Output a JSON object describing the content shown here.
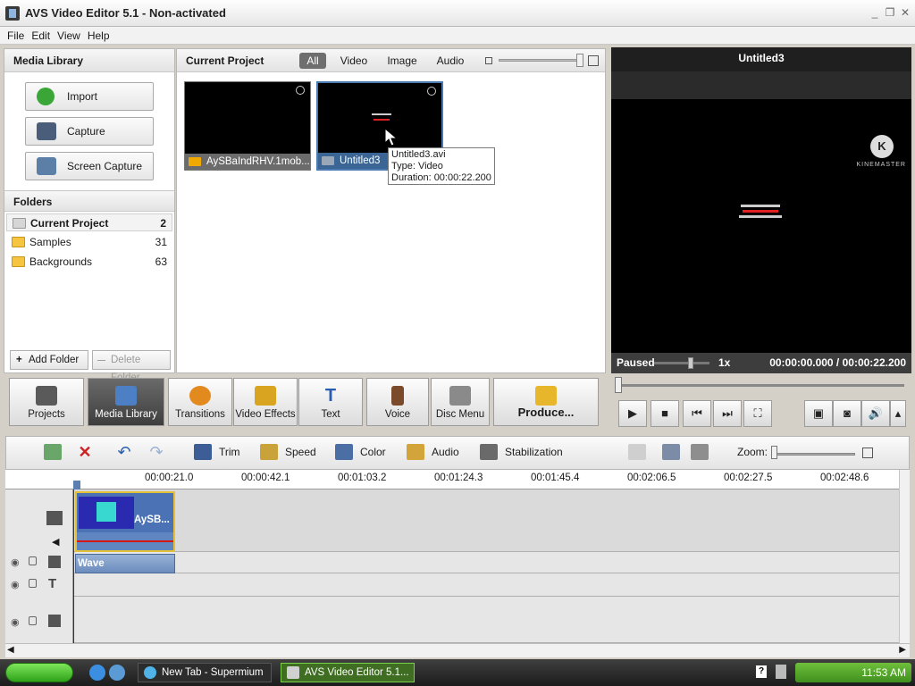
{
  "window": {
    "title": "AVS Video Editor 5.1 - Non-activated"
  },
  "menu": [
    "File",
    "Edit",
    "View",
    "Help"
  ],
  "media_library": {
    "title": "Media Library",
    "buttons": {
      "import": "Import",
      "capture": "Capture",
      "screen_capture": "Screen Capture"
    },
    "folders_title": "Folders",
    "folders": [
      {
        "name": "Current Project",
        "count": "2"
      },
      {
        "name": "Samples",
        "count": "31"
      },
      {
        "name": "Backgrounds",
        "count": "63"
      }
    ],
    "add_folder": "Add Folder",
    "delete_folder": "Delete Folder"
  },
  "project": {
    "title": "Current Project",
    "filters": [
      "All",
      "Video",
      "Image",
      "Audio"
    ],
    "clips": [
      {
        "name": "AySBaIndRHV.1mob..."
      },
      {
        "name": "Untitled3"
      }
    ],
    "tooltip": {
      "line1": "Untitled3.avi",
      "line2": "Type: Video",
      "line3": "Duration: 00:00:22.200"
    }
  },
  "preview": {
    "title": "Untitled3",
    "logo_letter": "K",
    "logo_text": "KINEMASTER",
    "status": "Paused",
    "speed": "1x",
    "time": "00:00:00.000 / 00:00:22.200"
  },
  "toolbar": {
    "buttons": [
      "Projects",
      "Media Library",
      "Transitions",
      "Video Effects",
      "Text",
      "Voice",
      "Disc Menu"
    ],
    "produce": "Produce..."
  },
  "timeline": {
    "tools": [
      "Trim",
      "Speed",
      "Color",
      "Audio",
      "Stabilization"
    ],
    "zoom_label": "Zoom:",
    "ticks": [
      "00:00:21.0",
      "00:00:42.1",
      "00:01:03.2",
      "00:01:24.3",
      "00:01:45.4",
      "00:02:06.5",
      "00:02:27.5",
      "00:02:48.6"
    ],
    "clip_label": "AySB...",
    "wave_label": "Wave"
  },
  "taskbar": {
    "tasks": [
      "New Tab - Supermium",
      "AVS Video Editor 5.1..."
    ],
    "clock": "11:53 AM"
  },
  "colors": {
    "accent": "#3b6594",
    "preview_bg": "#2b2b2b",
    "clip_border": "#e3c23a"
  }
}
